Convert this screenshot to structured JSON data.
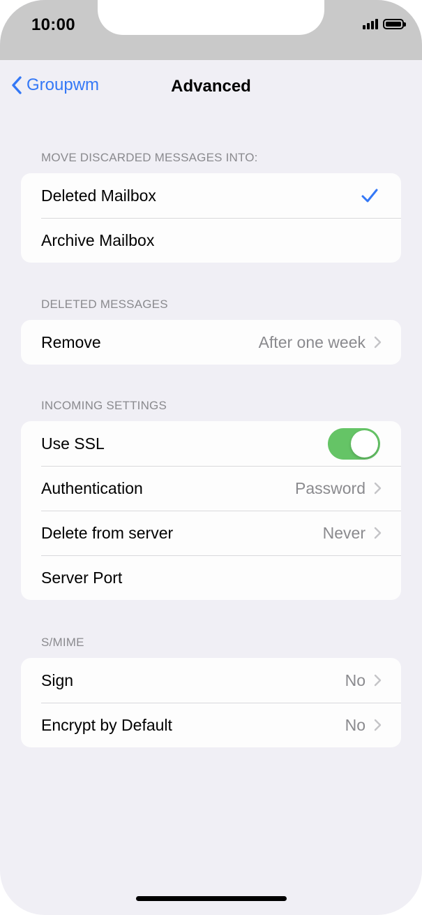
{
  "status_bar": {
    "time": "10:00"
  },
  "nav": {
    "back_label": "Groupwm",
    "title": "Advanced"
  },
  "sections": {
    "discarded": {
      "header": "MOVE DISCARDED MESSAGES INTO:",
      "rows": [
        {
          "label": "Deleted Mailbox",
          "selected": true
        },
        {
          "label": "Archive Mailbox",
          "selected": false
        }
      ]
    },
    "deleted": {
      "header": "DELETED MESSAGES",
      "rows": [
        {
          "label": "Remove",
          "value": "After one week"
        }
      ]
    },
    "incoming": {
      "header": "INCOMING SETTINGS",
      "rows": [
        {
          "label": "Use SSL",
          "toggle_on": true
        },
        {
          "label": "Authentication",
          "value": "Password"
        },
        {
          "label": "Delete from server",
          "value": "Never"
        },
        {
          "label": "Server Port"
        }
      ]
    },
    "smime": {
      "header": "S/MIME",
      "rows": [
        {
          "label": "Sign",
          "value": "No"
        },
        {
          "label": "Encrypt by Default",
          "value": "No"
        }
      ]
    }
  },
  "icons": {
    "back": "chevron-left-icon",
    "disclosure": "chevron-right-icon",
    "selected": "checkmark-icon"
  },
  "colors": {
    "accent": "#3478f6",
    "toggle_on": "#65c466",
    "background": "#f0eff5",
    "secondary_text": "#8a8a8e"
  }
}
